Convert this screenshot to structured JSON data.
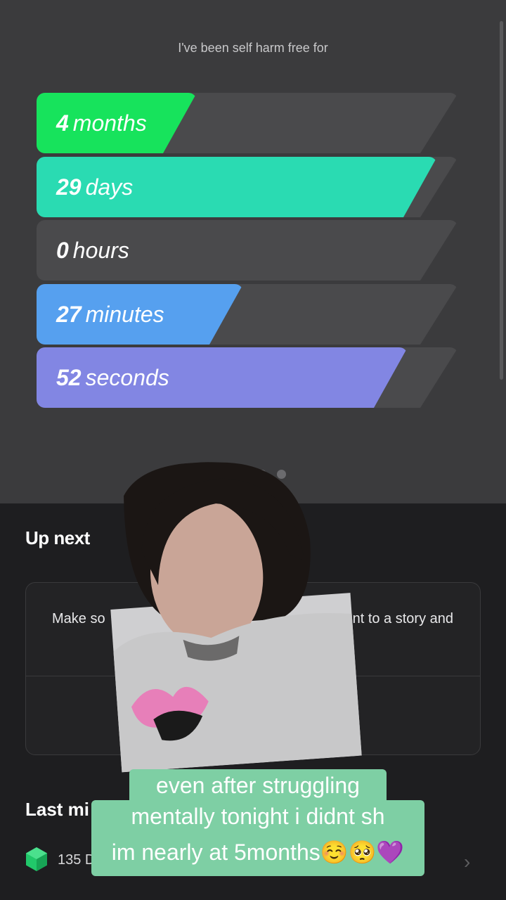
{
  "streak": {
    "heading": "I've been self harm free for",
    "bars": [
      {
        "number": "4",
        "unit": "months",
        "fill": 0.38,
        "color": "#17e35c",
        "tail_color": "#2a7a46"
      },
      {
        "number": "29",
        "unit": "days",
        "fill": 0.95,
        "color": "#2adbb2",
        "tail_color": "#2a7a6a"
      },
      {
        "number": "0",
        "unit": "hours",
        "fill": 0,
        "color": "#4a4a4c",
        "tail_color": "#4a4a4c"
      },
      {
        "number": "27",
        "unit": "minutes",
        "fill": 0.49,
        "color": "#56a0ef",
        "tail_color": "#4a4a4c"
      },
      {
        "number": "52",
        "unit": "seconds",
        "fill": 0.88,
        "color": "#8286e3",
        "tail_color": "#4a4a4c"
      }
    ],
    "page_dots": 2
  },
  "up_next": {
    "title": "Up next",
    "text_left": "Make so",
    "text_right": "nt to a story and"
  },
  "last_milestone": {
    "title": "Last mi",
    "count": "135 D"
  },
  "caption": {
    "line1": "even after struggling",
    "line2": "mentally tonight i didnt sh",
    "line3": "im nearly at 5months☺️🥺💜"
  },
  "colors": {
    "top_bg": "#3b3b3d",
    "bottom_bg": "#1e1e20",
    "caption_bg": "#7ecfa4",
    "hex_icon": "#21c86a"
  }
}
